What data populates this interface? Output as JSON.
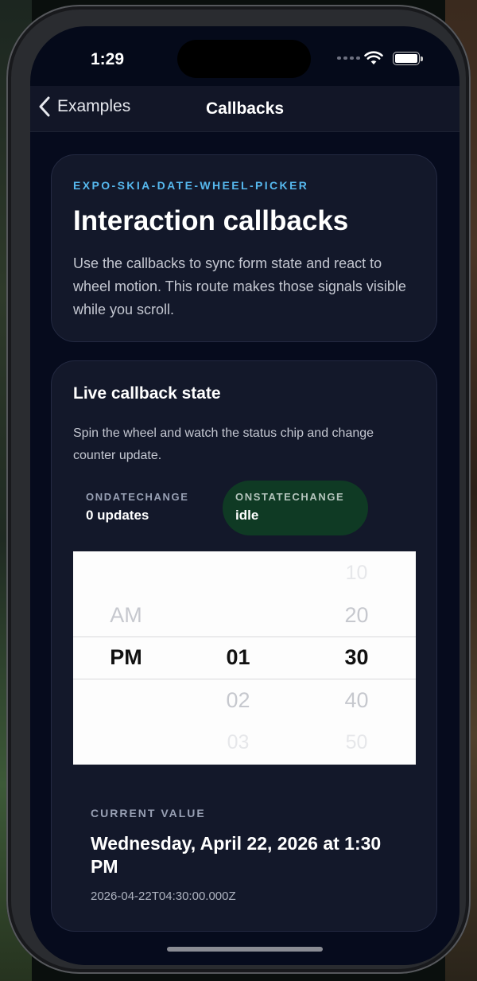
{
  "status": {
    "time": "1:29"
  },
  "nav": {
    "back_label": "Examples",
    "title": "Callbacks"
  },
  "intro": {
    "eyebrow": "EXPO-SKIA-DATE-WHEEL-PICKER",
    "title": "Interaction callbacks",
    "description": "Use the callbacks to sync form state and react to wheel motion. This route makes those signals visible while you scroll."
  },
  "live": {
    "title": "Live callback state",
    "description": "Spin the wheel and watch the status chip and change counter update.",
    "chips": [
      {
        "label": "ONDATECHANGE",
        "value": "0 updates"
      },
      {
        "label": "ONSTATECHANGE",
        "value": "idle",
        "color": "#0f3a24"
      }
    ]
  },
  "picker": {
    "period": {
      "near_above": "AM",
      "selected": "PM"
    },
    "hour": {
      "selected": "01",
      "near_below": "02",
      "far_below": "03"
    },
    "minute": {
      "far_above": "10",
      "near_above": "20",
      "selected": "30",
      "near_below": "40",
      "far_below": "50"
    }
  },
  "current": {
    "label": "CURRENT VALUE",
    "formatted": "Wednesday, April 22, 2026 at 1:30 PM",
    "iso": "2026-04-22T04:30:00.000Z"
  },
  "colors": {
    "accent": "#56b8ee",
    "chip_active": "#0f3a24",
    "background": "#060b1d"
  }
}
